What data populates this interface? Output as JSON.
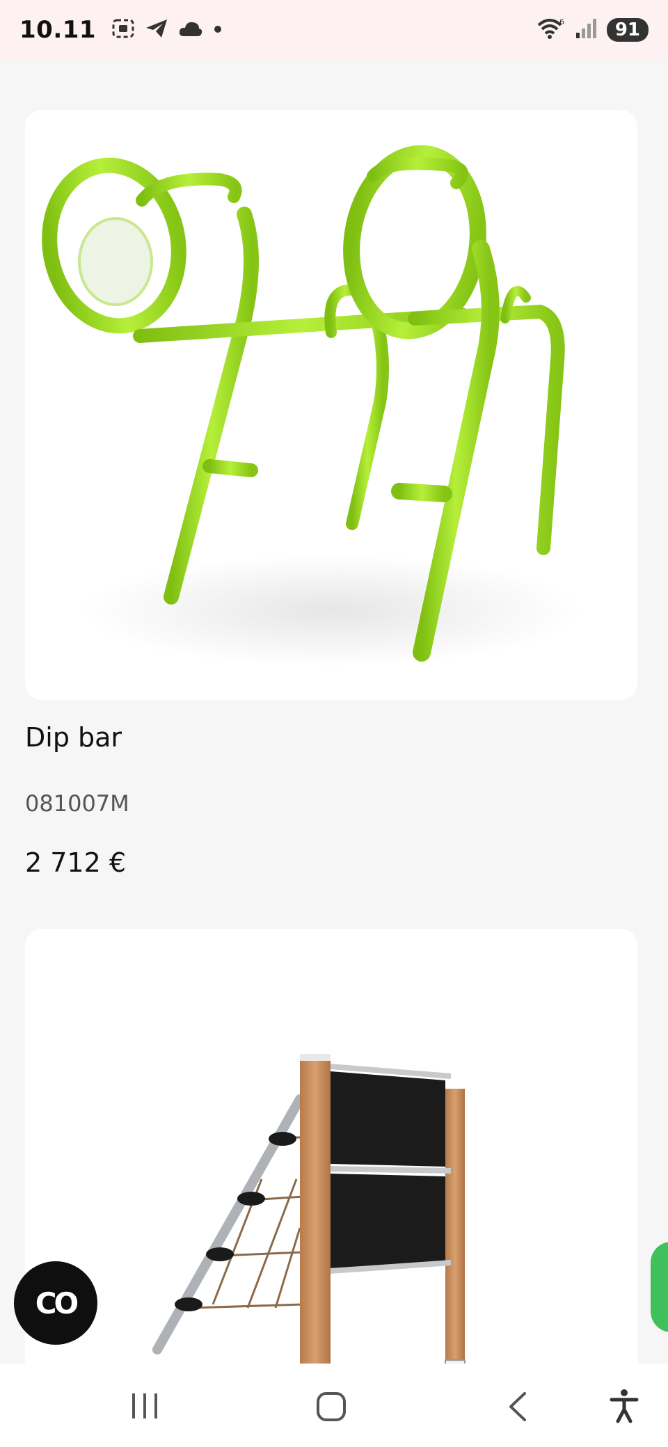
{
  "status_bar": {
    "time": "10.11",
    "battery": "91",
    "icons": [
      "screen-record-icon",
      "telegram-icon",
      "cloud-icon",
      "dot-icon",
      "wifi-icon",
      "signal-icon"
    ]
  },
  "products": [
    {
      "name": "Dip bar",
      "code": "081007M",
      "price": "2 712 €",
      "image": "green-dip-bar-image"
    },
    {
      "image": "climbing-wall-net-image"
    }
  ],
  "floating": {
    "co_label": "CO"
  },
  "nav": {
    "items": [
      "recent-apps-icon",
      "home-icon",
      "back-icon",
      "accessibility-icon"
    ]
  },
  "colors": {
    "accent_green": "#9ee01c",
    "background": "#f6f6f6",
    "fab_dark": "#0f0f0f"
  }
}
